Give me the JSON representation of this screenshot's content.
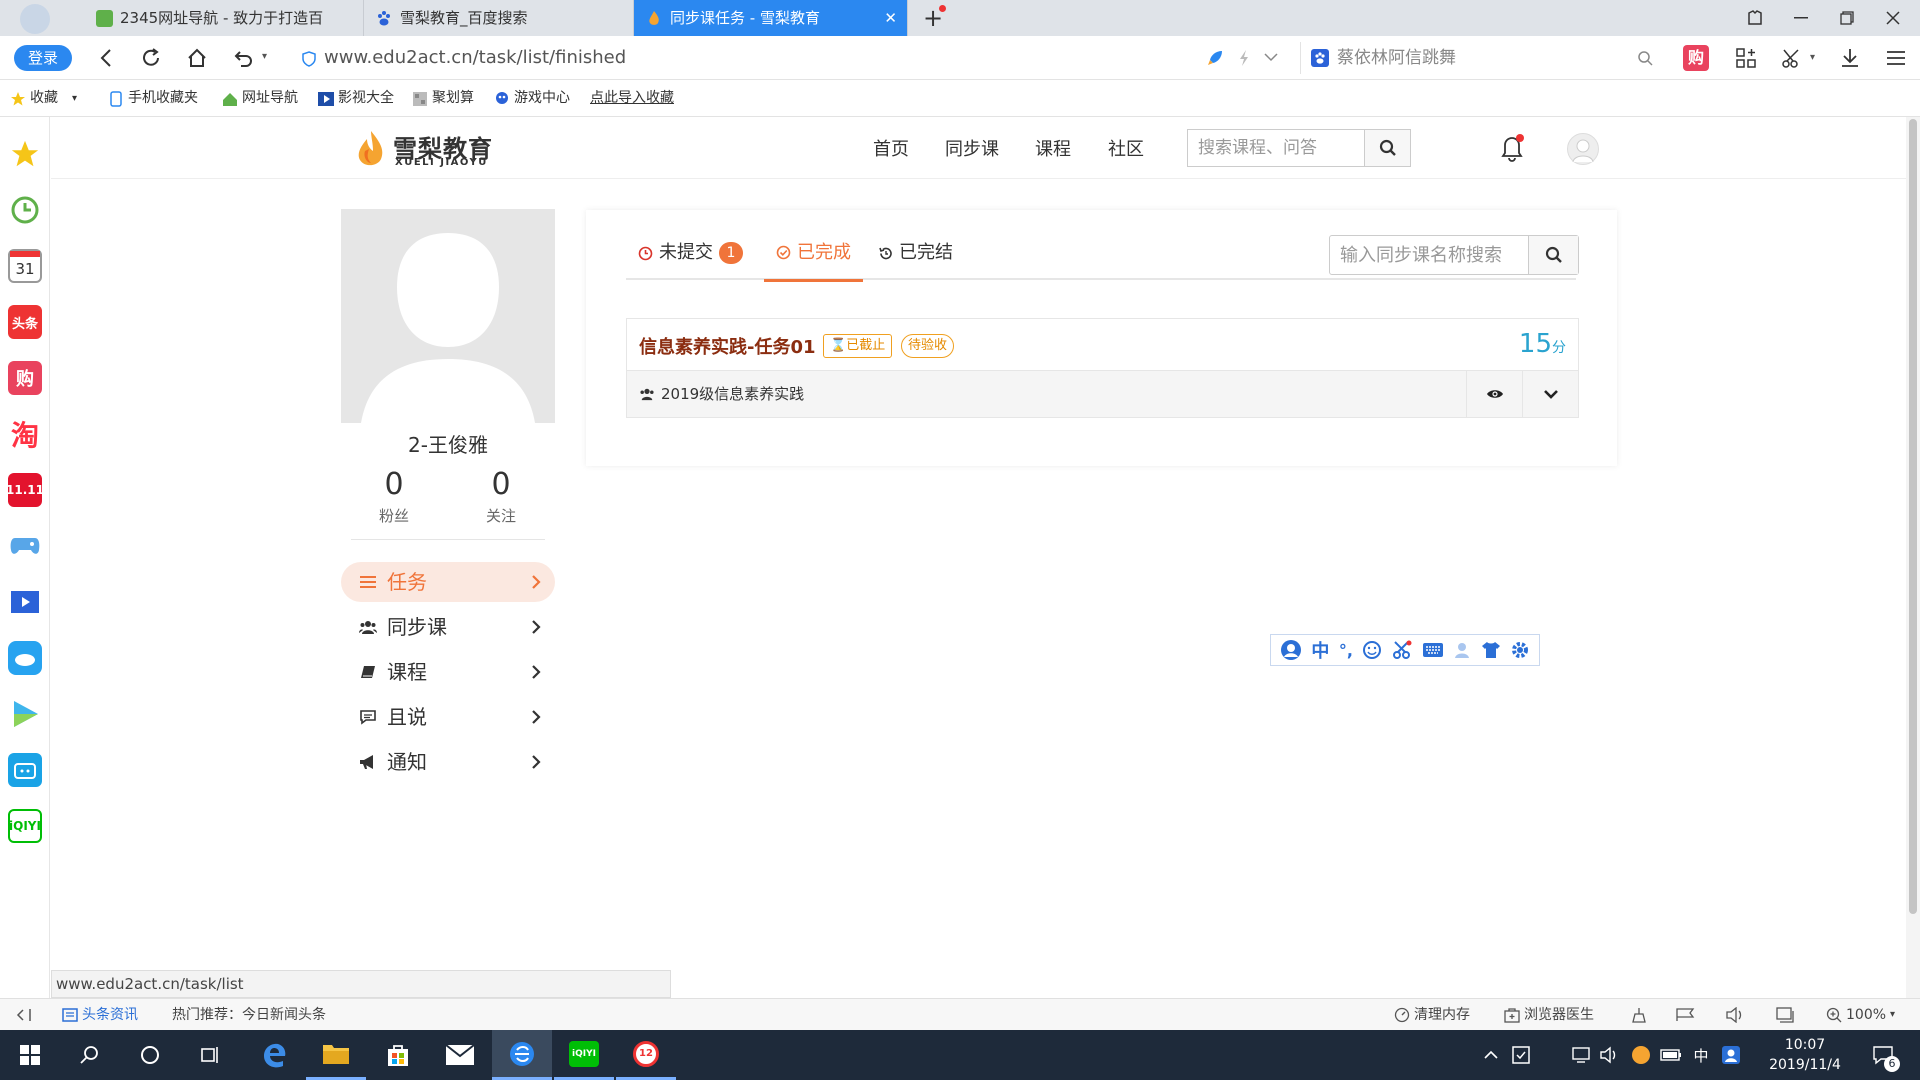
{
  "browser": {
    "tabs": [
      {
        "label": "2345网址导航 - 致力于打造百"
      },
      {
        "label": "雪梨教育_百度搜索"
      },
      {
        "label": "同步课任务 - 雪梨教育"
      }
    ],
    "login_label": "登录",
    "url": "www.edu2act.cn/task/list/finished",
    "search_engine_text": "蔡依林阿信跳舞",
    "bookmarks": [
      {
        "label": "收藏"
      },
      {
        "label": "手机收藏夹"
      },
      {
        "label": "网址导航"
      },
      {
        "label": "影视大全"
      },
      {
        "label": "聚划算"
      },
      {
        "label": "游戏中心"
      },
      {
        "label": "点此导入收藏"
      }
    ],
    "sidebar": {
      "calendar_day": "31",
      "toutiao": "头条",
      "gou": "购",
      "tao": "淘",
      "eleven": "11.11"
    }
  },
  "site": {
    "logo_cn": "雪梨教育",
    "logo_en": "XUELI JIAOYU",
    "nav": [
      {
        "label": "首页"
      },
      {
        "label": "同步课"
      },
      {
        "label": "课程"
      },
      {
        "label": "社区"
      }
    ],
    "search_placeholder": "搜索课程、问答"
  },
  "profile": {
    "name": "2-王俊雅",
    "fans_count": "0",
    "fans_label": "粉丝",
    "follow_count": "0",
    "follow_label": "关注",
    "menu": [
      {
        "label": "任务",
        "active": true
      },
      {
        "label": "同步课"
      },
      {
        "label": "课程"
      },
      {
        "label": "且说"
      },
      {
        "label": "通知"
      }
    ]
  },
  "tasks": {
    "tabs": [
      {
        "label": "未提交",
        "badge": "1"
      },
      {
        "label": "已完成",
        "active": true
      },
      {
        "label": "已完结"
      }
    ],
    "search_placeholder": "输入同步课名称搜索",
    "items": [
      {
        "title": "信息素养实践-任务01",
        "tag_expired": "已截止",
        "tag_pending": "待验收",
        "score": "15",
        "score_unit": "分",
        "course": "2019级信息素养实践"
      }
    ]
  },
  "ime": {
    "lang": "中",
    "punct": "°,"
  },
  "status_url": "www.edu2act.cn/task/list",
  "statusbar": {
    "news_label": "头条资讯",
    "hot_label": "热门推荐：今日新闻头条",
    "clean_label": "清理内存",
    "doctor_label": "浏览器医生",
    "zoom": "100%"
  },
  "taskbar": {
    "time": "10:07",
    "date": "2019/11/4",
    "ime_lang": "中",
    "notification_count": "6",
    "app_badge": "12"
  },
  "colors": {
    "accent": "#f0743a",
    "browser_blue": "#2b88f0",
    "task_title": "#8b2d10",
    "score": "#2aa3cf",
    "tag": "#e58a00"
  }
}
